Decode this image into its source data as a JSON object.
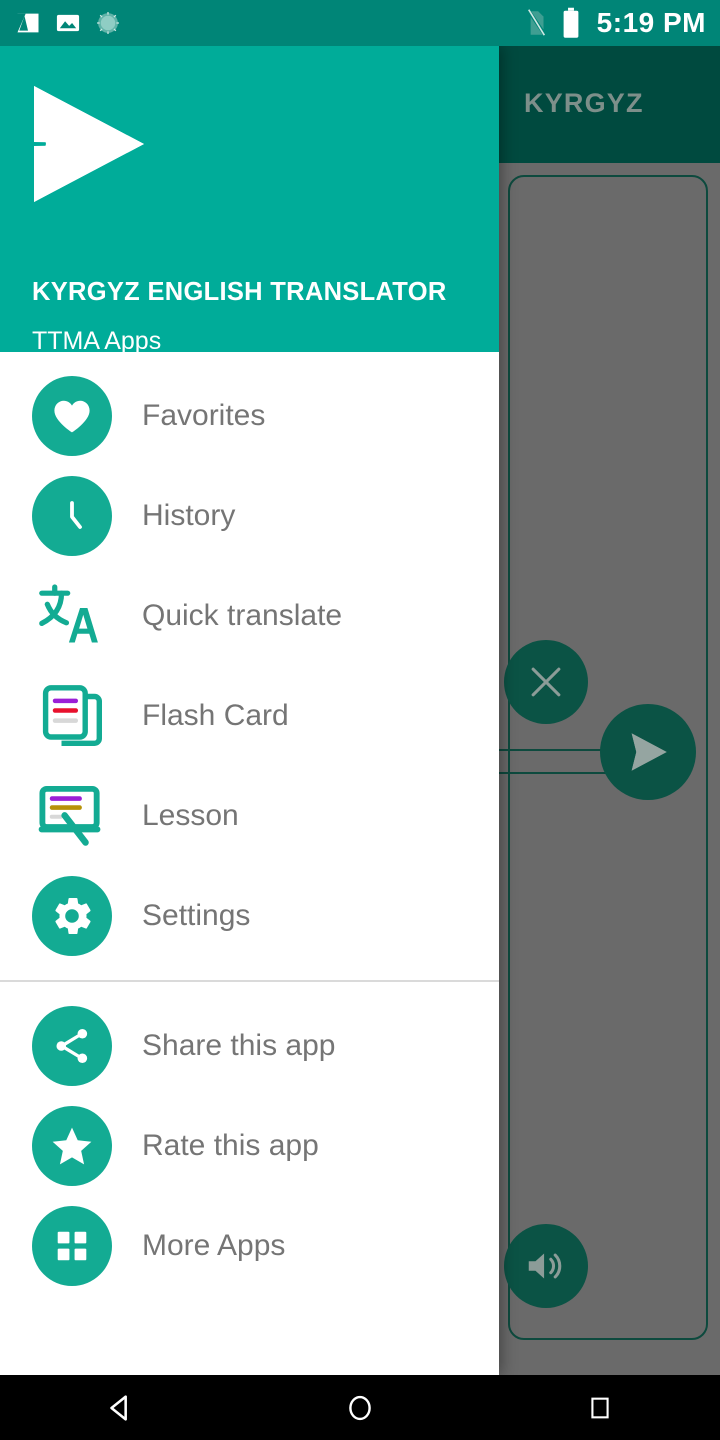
{
  "status_bar": {
    "time": "5:19 PM",
    "icons": [
      "screenshot-icon",
      "gallery-image-icon",
      "sync-spinner-icon"
    ],
    "right_icons": [
      "sim-card-off-icon",
      "battery-full-icon"
    ],
    "background_color": "#008577"
  },
  "drawer": {
    "app_name": "KYRGYZ ENGLISH TRANSLATOR",
    "app_subtitle": "TTMA Apps",
    "header_color": "#00ac99",
    "logo": "send-paper-plane-logo",
    "primary_items": [
      {
        "label": "Favorites",
        "icon": "heart-icon",
        "style": "circle"
      },
      {
        "label": "History",
        "icon": "clock-icon",
        "style": "circle"
      },
      {
        "label": "Quick translate",
        "icon": "translate-icon",
        "style": "plain"
      },
      {
        "label": "Flash Card",
        "icon": "flash-card-icon",
        "style": "plain"
      },
      {
        "label": "Lesson",
        "icon": "lesson-whiteboard-icon",
        "style": "plain"
      },
      {
        "label": "Settings",
        "icon": "gear-icon",
        "style": "circle"
      }
    ],
    "secondary_items": [
      {
        "label": "Share this app",
        "icon": "share-icon",
        "style": "circle"
      },
      {
        "label": "Rate this app",
        "icon": "star-icon",
        "style": "circle"
      },
      {
        "label": "More Apps",
        "icon": "grid-apps-icon",
        "style": "circle"
      }
    ],
    "icon_color": "#13ab93",
    "label_color": "#757575"
  },
  "background_activity": {
    "toolbar_title": "KYRGYZ",
    "toolbar_color": "#004a3f",
    "scrim_color": "#6a6a6a",
    "outline_color": "#0d4a3e",
    "buttons": [
      {
        "name": "clear-button",
        "icon": "close-x-icon"
      },
      {
        "name": "translate-fab",
        "icon": "send-paper-plane-icon"
      },
      {
        "name": "speak-button",
        "icon": "speaker-volume-icon"
      }
    ]
  },
  "nav_bar": {
    "buttons": [
      {
        "label": "Back",
        "icon": "back-triangle-icon"
      },
      {
        "label": "Home",
        "icon": "home-circle-icon"
      },
      {
        "label": "Recents",
        "icon": "recents-square-icon"
      }
    ],
    "background_color": "#000000"
  }
}
